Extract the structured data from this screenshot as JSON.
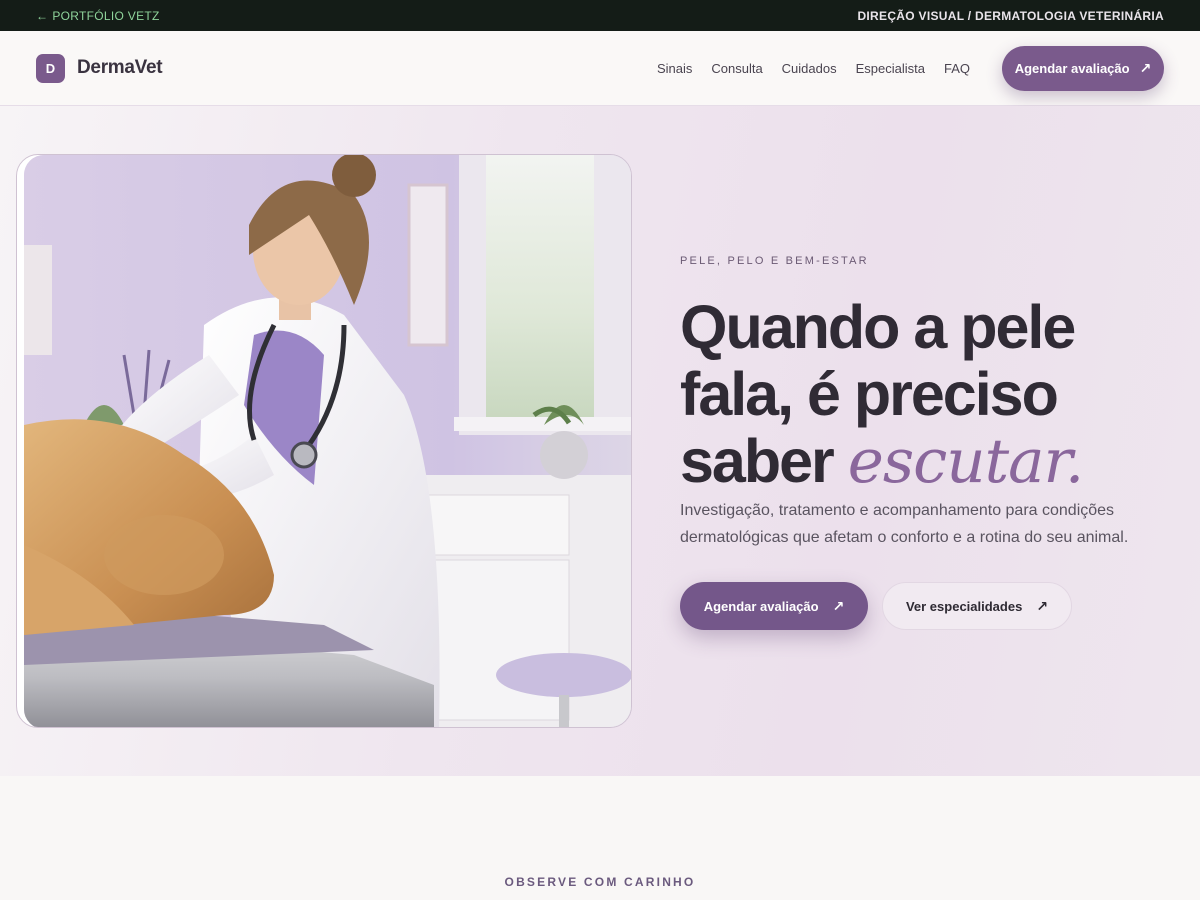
{
  "topbar": {
    "back_label": "PORTFÓLIO VETZ",
    "right_label": "DIREÇÃO VISUAL / DERMATOLOGIA VETERINÁRIA"
  },
  "header": {
    "logo_letter": "D",
    "brand": "DermaVet",
    "nav": [
      "Sinais",
      "Consulta",
      "Cuidados",
      "Especialista",
      "FAQ"
    ],
    "cta": "Agendar avaliação"
  },
  "hero": {
    "eyebrow": "PELE, PELO E BEM-ESTAR",
    "headline_main": "Quando a pele fala, é preciso saber ",
    "headline_em": "escutar.",
    "lead": "Investigação, tratamento e acompanhamento para condições dermatológicas que afetam o conforto e a rotina do seu animal.",
    "primary_cta": "Agendar avaliação",
    "secondary_cta": "Ver especialidades",
    "image_alt": "Veterinária examinando a pele de um cão golden retriever"
  },
  "next_section": {
    "eyebrow": "OBSERVE COM CARINHO"
  },
  "colors": {
    "brand": "#7a5a8c",
    "topbar_bg": "#141c17",
    "topbar_link": "#8fd49b",
    "headline_accent": "#8a679c"
  },
  "icons": {
    "back": "arrow-left-icon",
    "cta": "arrow-up-right-icon"
  }
}
